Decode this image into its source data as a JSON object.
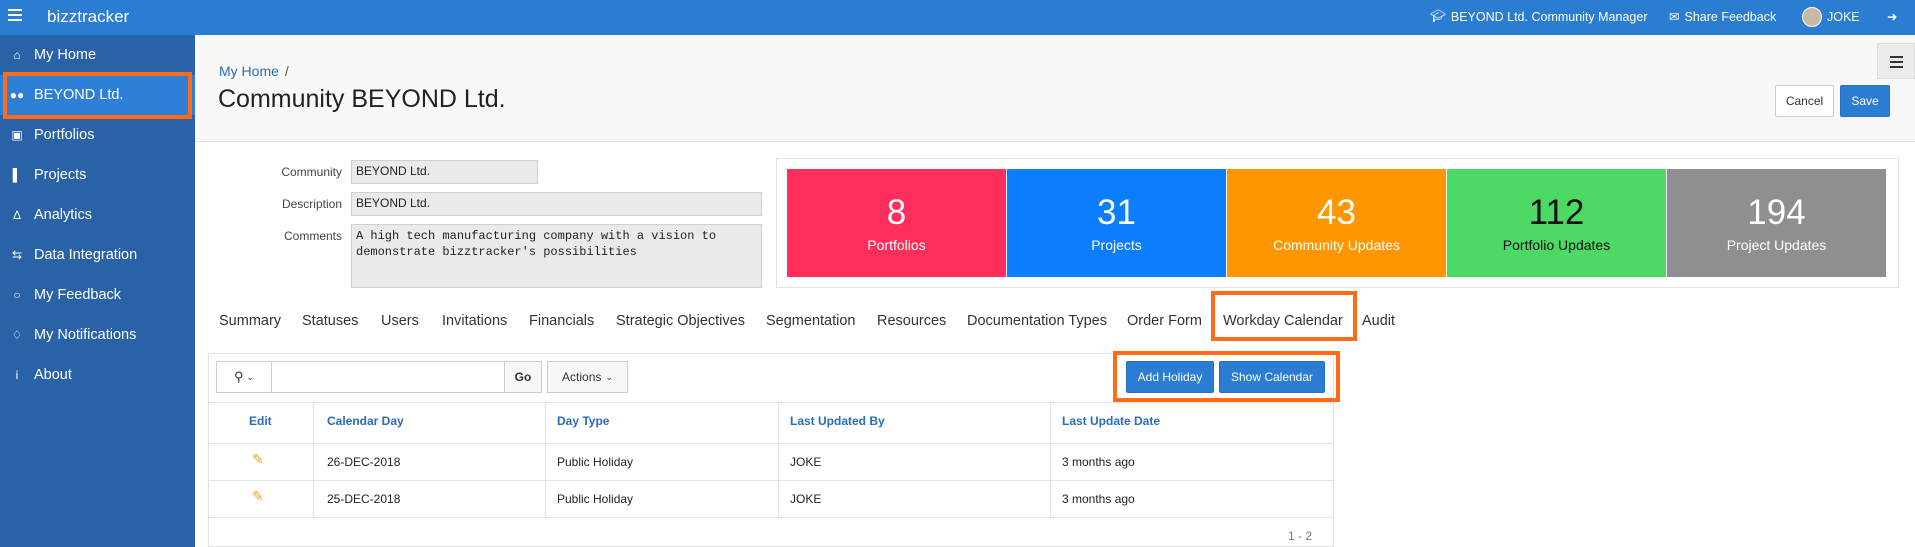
{
  "app": {
    "brand": "bizztracker"
  },
  "topbar": {
    "role": "BEYOND Ltd. Community Manager",
    "share_feedback": "Share Feedback",
    "user": "JOKE"
  },
  "sidebar": {
    "items": [
      {
        "label": "My Home",
        "icon": "home-icon"
      },
      {
        "label": "BEYOND Ltd.",
        "icon": "users-icon"
      },
      {
        "label": "Portfolios",
        "icon": "briefcase-icon"
      },
      {
        "label": "Projects",
        "icon": "bar-chart-icon"
      },
      {
        "label": "Analytics",
        "icon": "line-chart-icon"
      },
      {
        "label": "Data Integration",
        "icon": "exchange-icon"
      },
      {
        "label": "My Feedback",
        "icon": "comments-icon"
      },
      {
        "label": "My Notifications",
        "icon": "bell-icon"
      },
      {
        "label": "About",
        "icon": "info-icon"
      }
    ]
  },
  "header": {
    "breadcrumb": "My Home",
    "breadcrumb_sep": "/",
    "title": "Community BEYOND Ltd.",
    "cancel": "Cancel",
    "save": "Save"
  },
  "form": {
    "community_label": "Community",
    "community_value": "BEYOND Ltd.",
    "description_label": "Description",
    "description_value": "BEYOND Ltd.",
    "comments_label": "Comments",
    "comments_value": "A high tech manufacturing company with a vision to\ndemonstrate bizztracker's possibilities"
  },
  "stats": [
    {
      "value": "8",
      "label": "Portfolios",
      "color": "#ff2e5a"
    },
    {
      "value": "31",
      "label": "Projects",
      "color": "#0b7dff"
    },
    {
      "value": "43",
      "label": "Community Updates",
      "color": "#ff9600"
    },
    {
      "value": "112",
      "label": "Portfolio Updates",
      "color": "#4cd964"
    },
    {
      "value": "194",
      "label": "Project Updates",
      "color": "#8e8e93"
    }
  ],
  "tabs": [
    "Summary",
    "Statuses",
    "Users",
    "Invitations",
    "Financials",
    "Strategic Objectives",
    "Segmentation",
    "Resources",
    "Documentation Types",
    "Order Form",
    "Workday Calendar",
    "Audit"
  ],
  "toolbar": {
    "go": "Go",
    "actions": "Actions",
    "add_holiday": "Add Holiday",
    "show_calendar": "Show Calendar"
  },
  "table": {
    "columns": [
      "Edit",
      "Calendar Day",
      "Day Type",
      "Last Updated By",
      "Last Update Date"
    ],
    "rows": [
      {
        "day": "26-DEC-2018",
        "type": "Public Holiday",
        "by": "JOKE",
        "date": "3 months ago"
      },
      {
        "day": "25-DEC-2018",
        "type": "Public Holiday",
        "by": "JOKE",
        "date": "3 months ago"
      }
    ],
    "pagination": "1 - 2"
  }
}
